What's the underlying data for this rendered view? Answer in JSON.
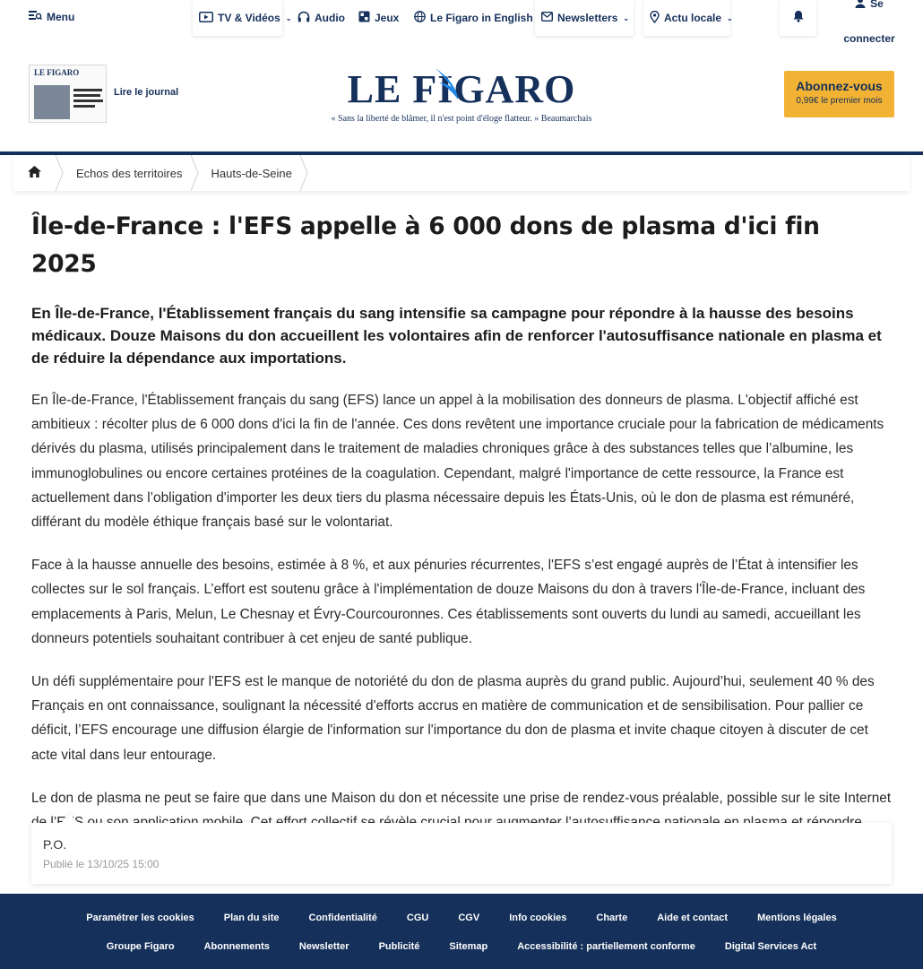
{
  "nav": {
    "menu": "Menu",
    "tv": "TV & Vidéos",
    "audio": "Audio",
    "games": "Jeux",
    "english": "Le Figaro in English",
    "newsletters": "Newsletters",
    "local": "Actu locale",
    "login_line1": "Se",
    "login_line2": "connecter"
  },
  "masthead": {
    "paper_label": "LE FIGARO",
    "read_paper": "Lire le journal",
    "logo": "LE FIGARO",
    "tagline": "« Sans la liberté de blâmer, il n'est point d'éloge flatteur. » Beaumarchais",
    "subscribe_title": "Abonnez-vous",
    "subscribe_sub": "0,99€ le premier mois"
  },
  "breadcrumb": [
    "Echos des territoires",
    "Hauts-de-Seine"
  ],
  "article": {
    "title": "Île-de-France : l'EFS appelle à 6 000 dons de plasma d'ici fin 2025",
    "standfirst": "En Île-de-France, l'Établissement français du sang intensifie sa campagne pour répondre à la hausse des besoins médicaux. Douze Maisons du don accueillent les volontaires afin de renforcer l'autosuffisance nationale en plasma et de réduire la dépendance aux importations.",
    "paragraphs": [
      "En Île-de-France, l'Établissement français du sang (EFS) lance un appel à la mobilisation des donneurs de plasma. L'objectif affiché est ambitieux : récolter plus de 6 000 dons d'ici la fin de l'année. Ces dons revêtent une importance cruciale pour la fabrication de médicaments dérivés du plasma, utilisés principalement dans le traitement de maladies chroniques grâce à des substances telles que l’albumine, les immunoglobulines ou encore certaines protéines de la coagulation. Cependant, malgré l'importance de cette ressource, la France est actuellement dans l’obligation d'importer les deux tiers du plasma nécessaire depuis les États-Unis, où le don de plasma est rémunéré, différant du modèle éthique français basé sur le volontariat.",
      "Face à la hausse annuelle des besoins, estimée à 8 %, et aux pénuries récurrentes, l'EFS s’est engagé auprès de l’État à intensifier les collectes sur le sol français. L’effort est soutenu grâce à l'implémentation de douze Maisons du don à travers l'Île-de-France, incluant des emplacements à Paris, Melun, Le Chesnay et Évry-Courcouronnes. Ces établissements sont ouverts du lundi au samedi, accueillant les donneurs potentiels souhaitant contribuer à cet enjeu de santé publique.",
      "Un défi supplémentaire pour l'EFS est le manque de notoriété du don de plasma auprès du grand public. Aujourd’hui, seulement 40 % des Français en ont connaissance, soulignant la nécessité d'efforts accrus en matière de communication et de sensibilisation. Pour pallier ce déficit, l’EFS encourage une diffusion élargie de l'information sur l'importance du don de plasma et invite chaque citoyen à discuter de cet acte vital dans leur entourage.",
      "Le don de plasma ne peut se faire que dans une Maison du don et nécessite une prise de rendez-vous préalable, possible sur le site Internet de l’EFS ou son application mobile. Cet effort collectif se révèle crucial pour augmenter l’autosuffisance nationale en plasma et répondre efficacement aux besoins médicaux croissants des patients."
    ],
    "author": "P.O.",
    "published": "Publié le 13/10/25 15:00"
  },
  "footer": {
    "row1": [
      "Paramétrer les cookies",
      "Plan du site",
      "Confidentialité",
      "CGU",
      "CGV",
      "Info cookies",
      "Charte",
      "Aide et contact",
      "Mentions légales"
    ],
    "row2": [
      "Groupe Figaro",
      "Abonnements",
      "Newsletter",
      "Publicité",
      "Sitemap",
      "Accessibilité : partiellement conforme",
      "Digital Services Act"
    ]
  },
  "colors": {
    "brand_navy": "#15305b",
    "subscribe_yellow": "#f2b233",
    "logo_bird_blue": "#1f88e5"
  }
}
